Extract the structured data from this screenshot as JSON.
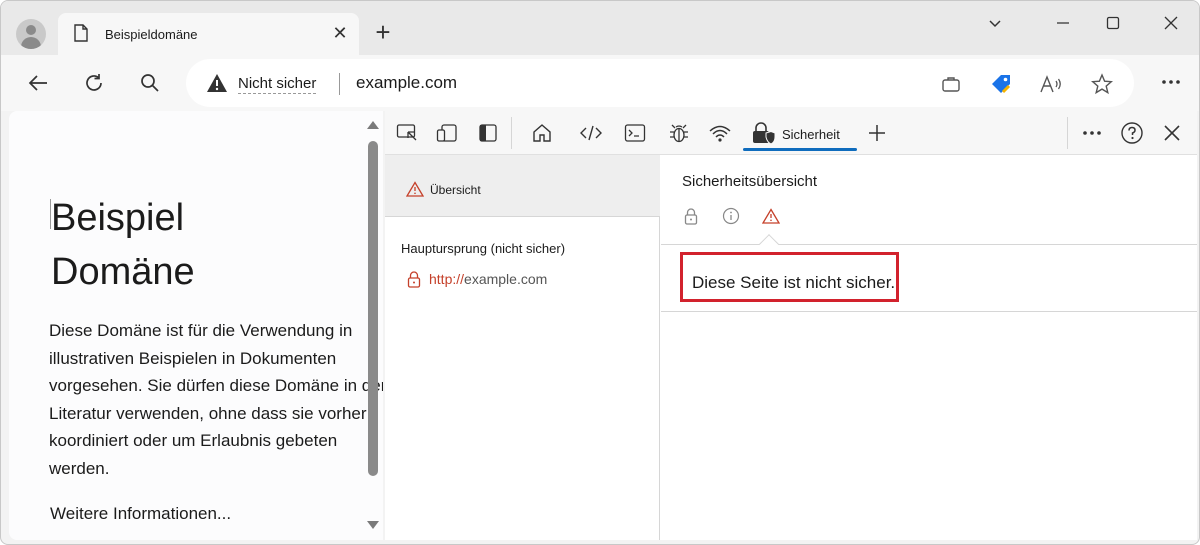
{
  "tab": {
    "title": "Beispieldomäne",
    "close": "✕"
  },
  "new_tab": "+",
  "address": {
    "security_label": "Nicht sicher",
    "url": "example.com"
  },
  "webpage": {
    "heading_line1": "Beispiel",
    "heading_line2": "Domäne",
    "paragraph": "Diese Domäne ist für die Verwendung in illustrativen Beispielen in Dokumenten vorgesehen. Sie dürfen diese Domäne in der Literatur verwenden, ohne dass sie vorher koordiniert oder um Erlaubnis gebeten werden.",
    "more_link": "Weitere Informationen..."
  },
  "devtools": {
    "active_tab": "Sicherheit",
    "left": {
      "overview": "Übersicht",
      "origin_header": "Hauptursprung (nicht sicher)",
      "origin_scheme": "http://",
      "origin_host": "example.com"
    },
    "right": {
      "title": "Sicherheitsübersicht",
      "message": "Diese Seite ist nicht sicher."
    }
  },
  "colors": {
    "accent": "#0f6cbd",
    "warning": "#c5402a",
    "highlight": "#d2222d"
  }
}
